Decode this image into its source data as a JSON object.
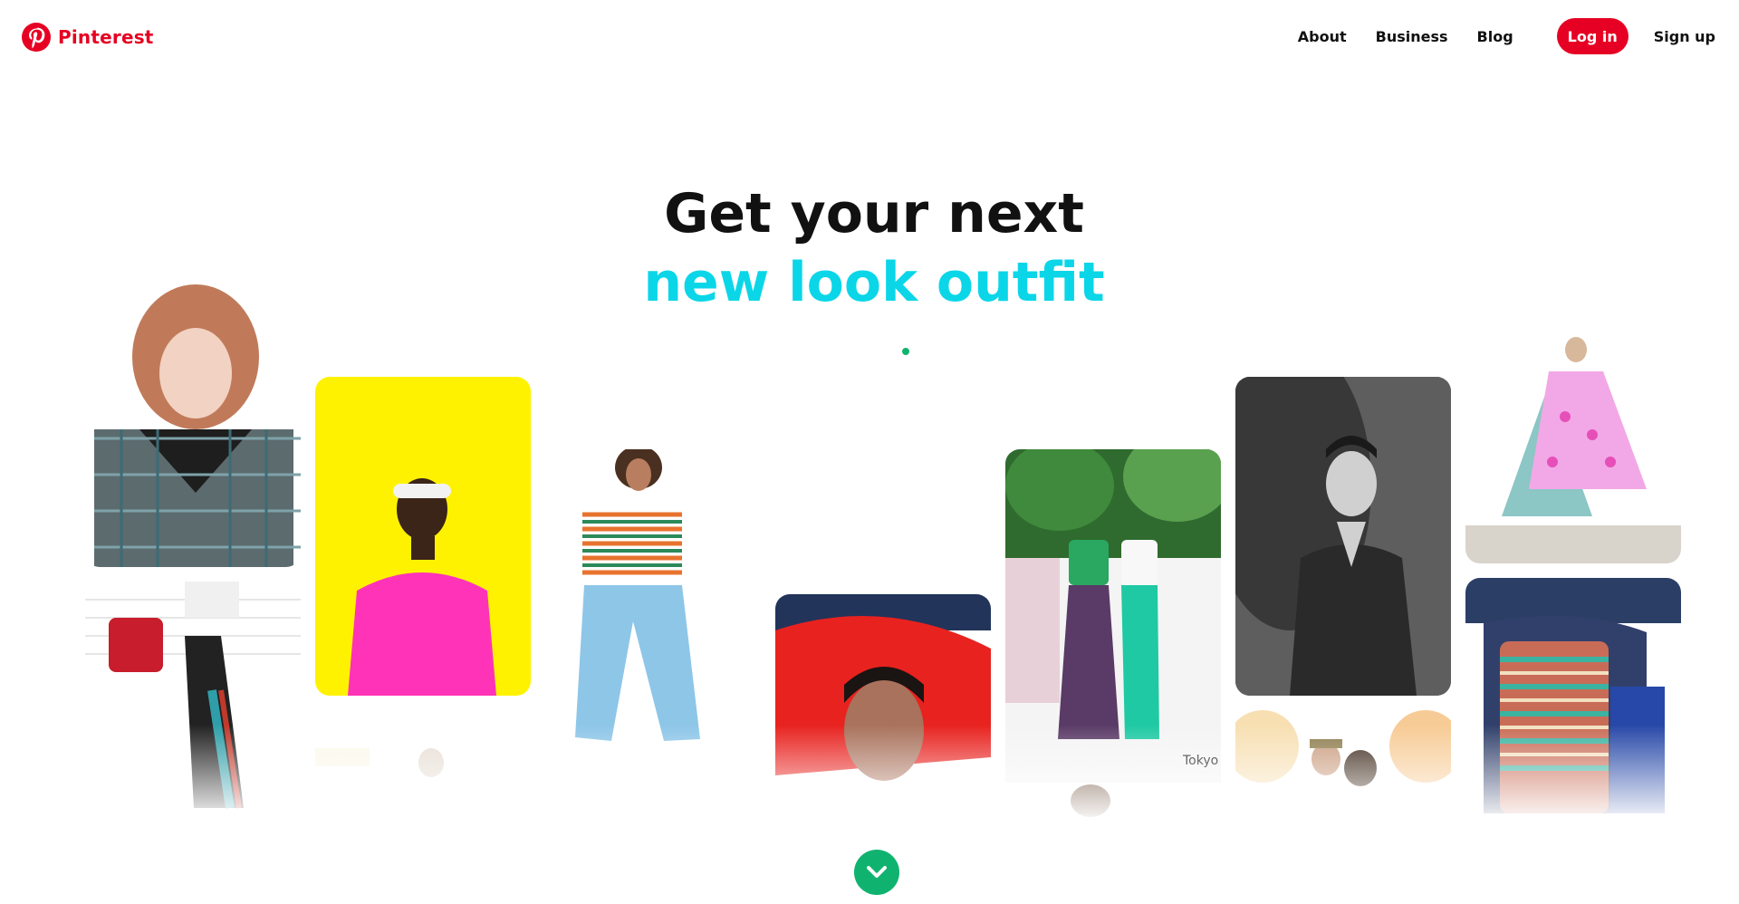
{
  "header": {
    "brand": "Pinterest",
    "nav": {
      "about": "About",
      "business": "Business",
      "blog": "Blog",
      "login": "Log in",
      "signup": "Sign up"
    }
  },
  "hero": {
    "line1": "Get your next",
    "line2": "new look outfit",
    "line2_color": "#0ad6e8"
  },
  "colors": {
    "brand_red": "#e60023",
    "accent_green": "#0fb36f"
  },
  "pins": [
    {
      "id": "pin-1"
    },
    {
      "id": "pin-2"
    },
    {
      "id": "pin-3"
    },
    {
      "id": "pin-4"
    },
    {
      "id": "pin-5"
    },
    {
      "id": "pin-6"
    },
    {
      "id": "pin-7"
    },
    {
      "id": "pin-8"
    },
    {
      "id": "pin-9"
    },
    {
      "id": "pin-10"
    },
    {
      "id": "pin-11"
    },
    {
      "id": "pin-12"
    },
    {
      "id": "pin-13"
    }
  ],
  "pin_texts": {
    "tokyo": "Tokyo"
  },
  "icons": {
    "logo": "pinterest-logo-icon",
    "scroll": "chevron-down-icon"
  }
}
